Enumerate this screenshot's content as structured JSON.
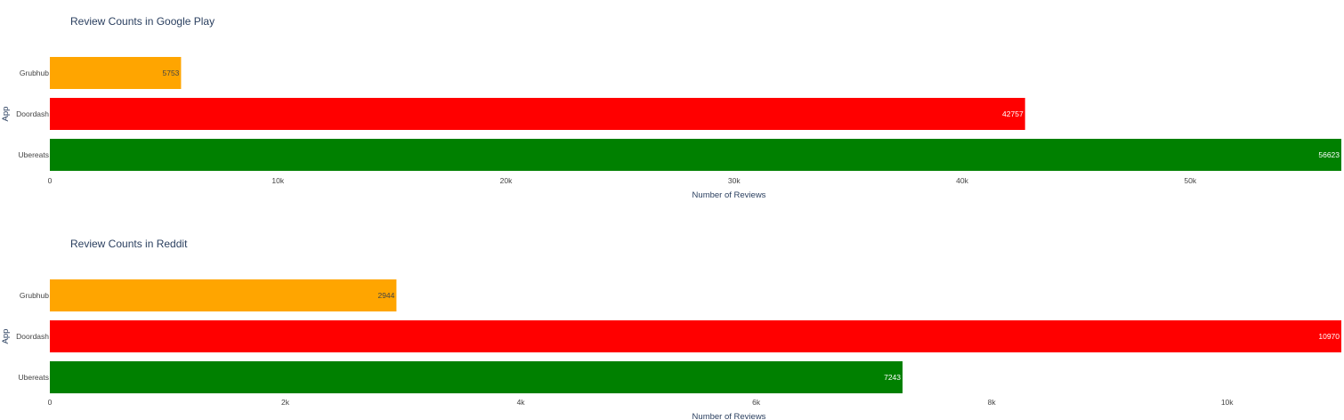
{
  "chart_data": [
    {
      "type": "bar",
      "orientation": "horizontal",
      "title": "Review Counts in Google Play",
      "xlabel": "Number of Reviews",
      "ylabel": "App",
      "categories": [
        "Grubhub",
        "Doordash",
        "Ubereats"
      ],
      "values": [
        5753,
        42757,
        56623
      ],
      "labels": [
        "5753",
        "42757",
        "56623"
      ],
      "colors": [
        "#FFA500",
        "#FF0000",
        "#008000"
      ],
      "label_colors": [
        "#444444",
        "#ffffff",
        "#ffffff"
      ],
      "xlim": [
        0,
        56623
      ],
      "xticks": [
        0,
        10000,
        20000,
        30000,
        40000,
        50000
      ],
      "xtick_labels": [
        "0",
        "10k",
        "20k",
        "30k",
        "40k",
        "50k"
      ],
      "grid": false,
      "legend": false
    },
    {
      "type": "bar",
      "orientation": "horizontal",
      "title": "Review Counts in Reddit",
      "xlabel": "Number of Reviews",
      "ylabel": "App",
      "categories": [
        "Grubhub",
        "Doordash",
        "Ubereats"
      ],
      "values": [
        2944,
        10970,
        7243
      ],
      "labels": [
        "2944",
        "10970",
        "7243"
      ],
      "colors": [
        "#FFA500",
        "#FF0000",
        "#008000"
      ],
      "label_colors": [
        "#444444",
        "#ffffff",
        "#ffffff"
      ],
      "xlim": [
        0,
        10970
      ],
      "xticks": [
        0,
        2000,
        4000,
        6000,
        8000,
        10000
      ],
      "xtick_labels": [
        "0",
        "2k",
        "4k",
        "6k",
        "8k",
        "10k"
      ],
      "grid": false,
      "legend": false
    }
  ]
}
